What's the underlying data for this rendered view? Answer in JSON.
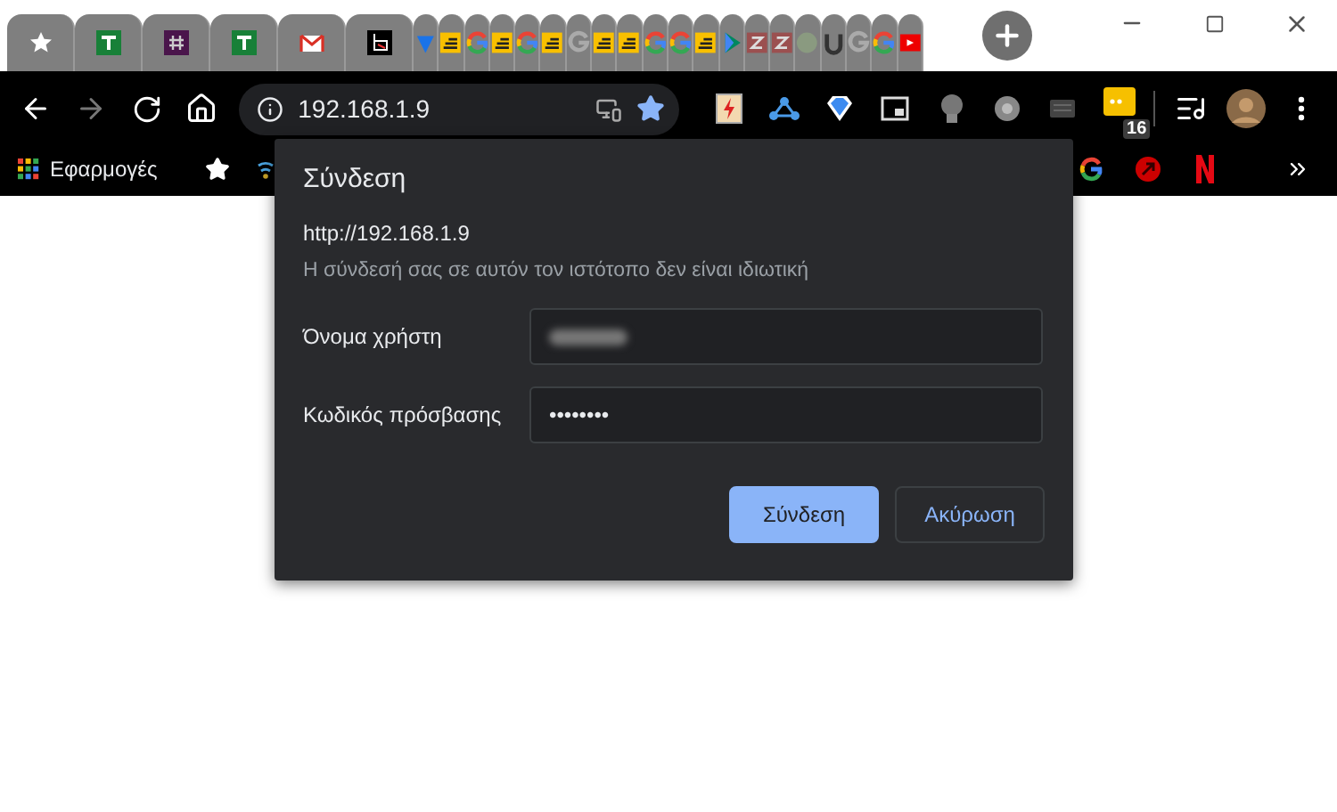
{
  "toolbar": {
    "address": "192.168.1.9",
    "extension_badge": "16"
  },
  "bookmarks_bar": {
    "apps_label": "Εφαρμογές"
  },
  "dialog": {
    "title": "Σύνδεση",
    "url": "http://192.168.1.9",
    "notice": "Η σύνδεσή σας σε αυτόν τον ιστότοπο δεν είναι ιδιωτική",
    "fields": [
      {
        "label": "Όνομα χρήστη",
        "kind": "blurred"
      },
      {
        "label": "Κωδικός πρόσβασης",
        "kind": "password",
        "value": "••••••••"
      }
    ],
    "buttons": [
      {
        "label": "Σύνδεση",
        "kind": "primary"
      },
      {
        "label": "Ακύρωση",
        "kind": "secondary"
      }
    ]
  }
}
